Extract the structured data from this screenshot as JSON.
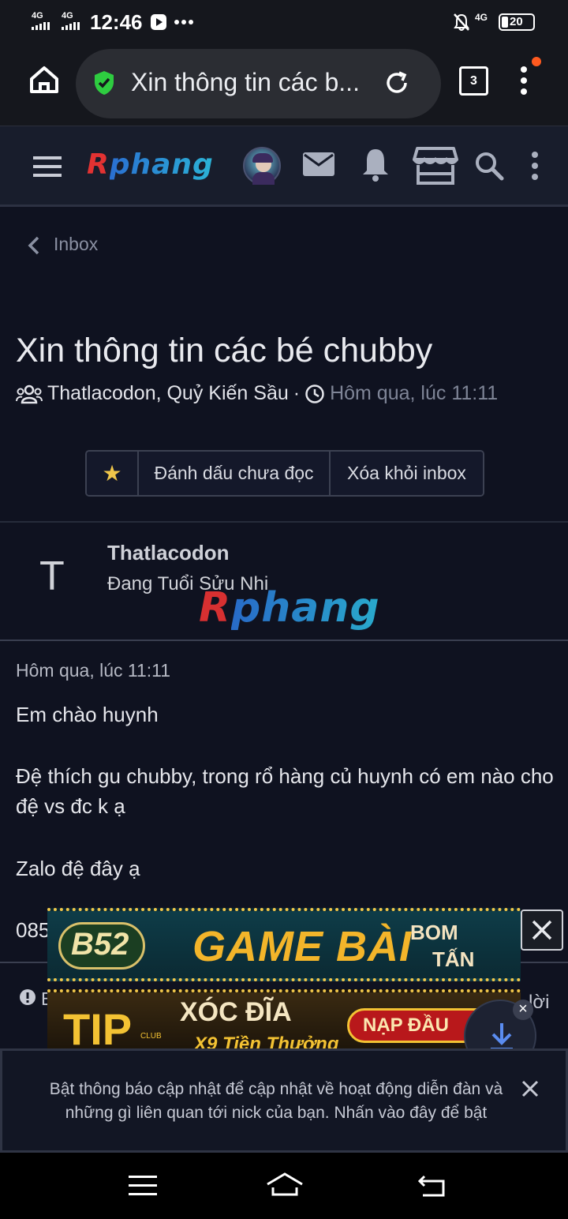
{
  "status_bar": {
    "network_1": "4G",
    "network_2": "4G",
    "time": "12:46",
    "network_right": "4G",
    "battery": "20"
  },
  "browser": {
    "url_title": "Xin thông tin các b...",
    "tabs_count": "3",
    "accent_colors": {
      "secure": "#2ecc40",
      "menu_dot": "#ff5a1f"
    }
  },
  "site": {
    "logo_r": "R",
    "logo_rest": "phang"
  },
  "breadcrumb": {
    "label": "Inbox"
  },
  "conversation": {
    "title": "Xin thông tin các bé chubby",
    "participants": "Thatlacodon, Quỷ Kiến Sầu",
    "separator": "·",
    "timestamp": "Hôm qua, lúc 11:11",
    "actions": {
      "star": "★",
      "mark_unread": "Đánh dấu chưa đọc",
      "remove_inbox": "Xóa khỏi inbox"
    }
  },
  "message": {
    "author_initial": "T",
    "author_name": "Thatlacodon",
    "author_title": "Đang Tuổi Sửu Nhi",
    "date": "Hôm qua, lúc 11:11",
    "greeting": "Em chào huynh",
    "body_1": "Đệ thích gu chubby, trong rổ hàng củ huynh có em nào cho đệ vs đc k ạ",
    "body_2": "Zalo đệ đây ạ",
    "body_3_visible": "085",
    "footer_fragment_left": "B",
    "footer_fragment_right": "lời"
  },
  "ads": {
    "ad1_brand": "B52",
    "ad1_title": "GAME BÀI",
    "ad1_tag_1": "BOM",
    "ad1_tag_2": "TẤN",
    "ad2_brand": "TIP",
    "ad2_sub": "CLUB",
    "ad2_title": "XÓC ĐĨA",
    "ad2_line2": "X9 Tiền Thưởng",
    "ad2_cta": "NẠP ĐẦU",
    "close": "×"
  },
  "notification": {
    "text": "Bật thông báo cập nhật để cập nhật về hoạt động diễn đàn và những gì liên quan tới nick của bạn. Nhấn vào đây để bật"
  }
}
